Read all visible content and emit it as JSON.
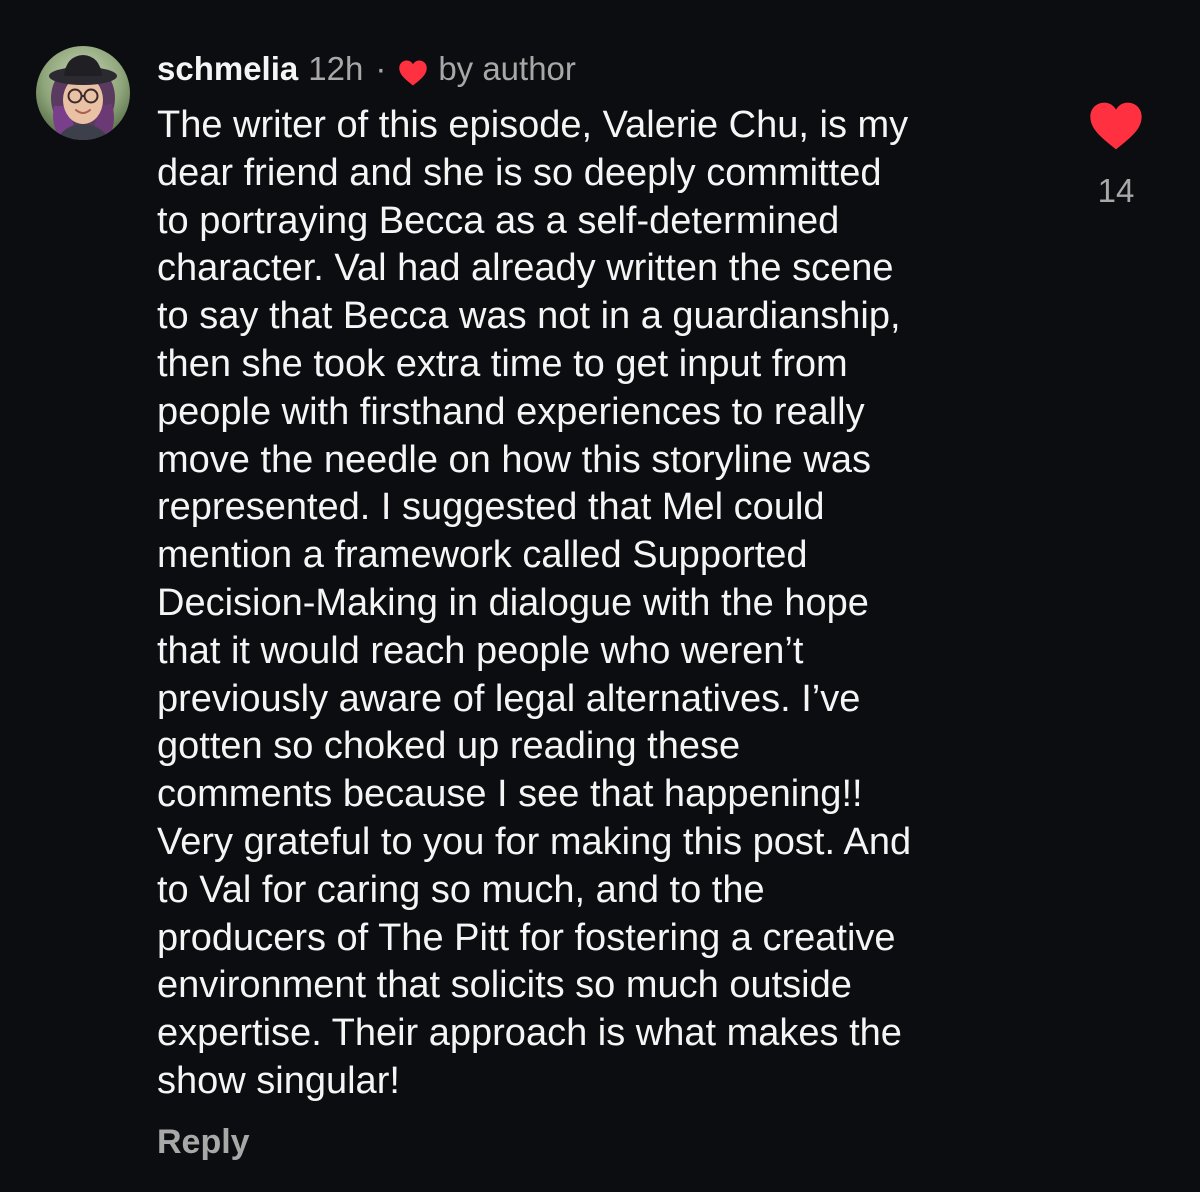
{
  "comment": {
    "username": "schmelia",
    "time": "12h",
    "separator": "·",
    "liked_by_author_label": "by author",
    "body_lines": [
      "The writer of this episode, Valerie Chu, is my",
      "dear friend and she is so deeply committed",
      "to portraying Becca as a self-determined",
      "character. Val had already written the scene",
      "to say that Becca was not in a guardianship,",
      "then she took extra time to get input from",
      "people with firsthand experiences to really",
      "move the needle on how this storyline was",
      "represented. I suggested that Mel could",
      "mention a framework called Supported",
      "Decision-Making in dialogue with the hope",
      "that it would reach people who weren’t",
      "previously aware of legal alternatives. I’ve",
      "gotten so choked up reading these",
      "comments because I see that happening!!",
      "Very grateful to you for making this post. And",
      "to Val for caring so much, and to the",
      "producers of The Pitt for fostering a creative",
      "environment that solicits so much outside",
      "expertise. Their approach is what makes the",
      "show singular!"
    ],
    "reply_label": "Reply",
    "like_count": "14",
    "liked": true
  },
  "icons": {
    "avatar": "avatar",
    "author_heart": "heart-icon",
    "like_heart": "heart-icon"
  },
  "colors": {
    "background": "#0c0d10",
    "text_primary": "#f5f5f5",
    "text_secondary": "#a8a8a8",
    "heart_red": "#ff3040"
  }
}
